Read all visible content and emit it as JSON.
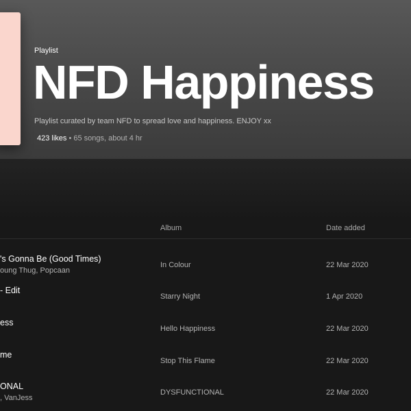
{
  "header": {
    "type_label": "Playlist",
    "title": "NFD Happiness",
    "description": "Playlist curated by team NFD to spread love and happiness. ENJOY xx",
    "likes": "423 likes",
    "separator": " • ",
    "songs_duration": "65 songs, about 4 hr",
    "cover_color": "#fad6cd"
  },
  "columns": {
    "album": "Album",
    "date_added": "Date added"
  },
  "tracks": [
    {
      "title": "'s Gonna Be (Good Times)",
      "artist": "oung Thug, Popcaan",
      "album": "In Colour",
      "date": "22 Mar 2020"
    },
    {
      "title": "- Edit",
      "artist": "",
      "album": "Starry Night",
      "date": "1 Apr 2020"
    },
    {
      "title": "ess",
      "artist": "",
      "album": "Hello Happiness",
      "date": "22 Mar 2020"
    },
    {
      "title": "me",
      "artist": "",
      "album": "Stop This Flame",
      "date": "22 Mar 2020"
    },
    {
      "title": "ONAL",
      "artist": ", VanJess",
      "album": "DYSFUNCTIONAL",
      "date": "22 Mar 2020"
    }
  ]
}
